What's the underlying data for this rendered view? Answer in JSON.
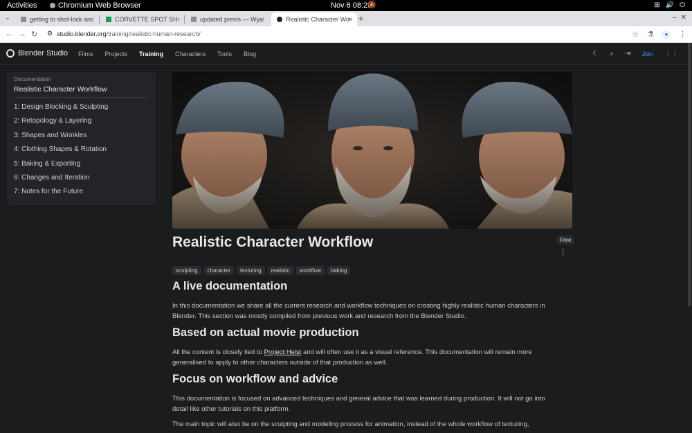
{
  "system_bar": {
    "activities": "Activities",
    "app_name": "Chromium Web Browser",
    "clock": "Nov 6  08:28"
  },
  "browser": {
    "tabs": [
      {
        "label": "getting to shot-lock and",
        "favicon_color": "#8e8e8e"
      },
      {
        "label": "CORVETTE SPOT SHOT L",
        "favicon_color": "#0f9d58"
      },
      {
        "label": "updated previs — Wyatt",
        "favicon_color": "#8e8e8e"
      },
      {
        "label": "Realistic Character Work",
        "favicon_color": "#202124"
      }
    ],
    "new_tab": "+",
    "url_host": "studio.blender.org",
    "url_path": "/training/realistic-human-research/"
  },
  "site": {
    "brand": "Blender Studio",
    "nav": [
      "Films",
      "Projects",
      "Training",
      "Characters",
      "Tools",
      "Blog"
    ],
    "join": "Join"
  },
  "sidebar": {
    "kicker": "Documentation",
    "title": "Realistic Character Workflow",
    "items": [
      "1: Design Blocking & Sculpting",
      "2: Retopology & Layering",
      "3: Shapes and Wrinkles",
      "4: Clothing Shapes & Rotation",
      "5: Baking & Exporting",
      "6: Changes and Iteration",
      "7: Notes for the Future"
    ]
  },
  "content": {
    "title": "Realistic Character Workflow",
    "badge": "Free",
    "tags": [
      "sculpting",
      "character",
      "texturing",
      "realistic",
      "workflow",
      "baking"
    ],
    "sections": [
      {
        "heading": "A live documentation",
        "body": "In this documentation we share all the current research and workflow techniques on creating highly realistic human characters in Blender. This section was mostly compiled from previous work and research from the Blender Studio."
      },
      {
        "heading": "Based on actual movie production",
        "body_before": "All the content is closely tied to ",
        "link": "Project Heist",
        "body_after": " and will often use it as a visual reference. This documentation will remain more generalised to apply to other characters outside of that production as well."
      },
      {
        "heading": "Focus on workflow and advice",
        "body": "This documentation is focused on advanced techniques and general advice that was learned during production. It will not go into detail like other tutorials on this platform.",
        "body2": "The main topic will also be on the sculpting and modeling process for animation, instead of the whole workflow of texturing,"
      }
    ]
  }
}
